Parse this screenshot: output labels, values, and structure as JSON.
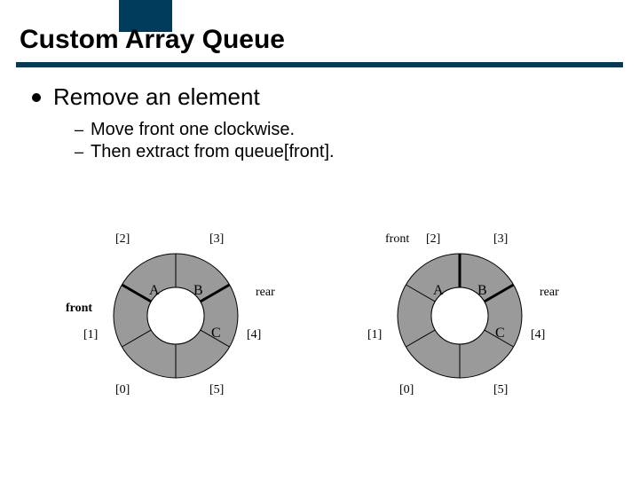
{
  "title": "Custom Array Queue",
  "bullet": "Remove an element",
  "sub": [
    "Move front one clockwise.",
    "Then extract from queue[front]."
  ],
  "ring_common": {
    "indices": [
      "[0]",
      "[1]",
      "[2]",
      "[3]",
      "[4]",
      "[5]"
    ],
    "rear_label": "rear"
  },
  "rings": [
    {
      "front_label": "front",
      "front_bold_left": true,
      "front_at_top": false,
      "cells": {
        "c1": "",
        "c2": "A",
        "c3": "B",
        "c4": "",
        "cC": "C"
      }
    },
    {
      "front_label": "front",
      "front_bold_left": false,
      "front_at_top": true,
      "cells": {
        "c1": "",
        "c2": "A",
        "c3": "B",
        "c4": "",
        "cC": "C"
      }
    }
  ]
}
